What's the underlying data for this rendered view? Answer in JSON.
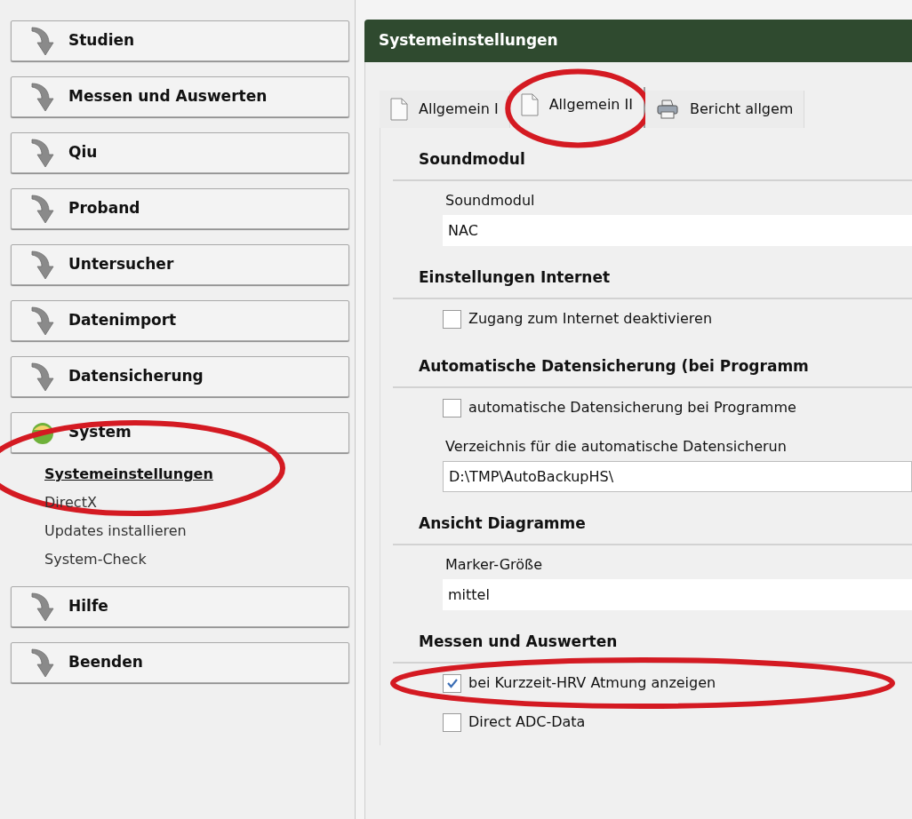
{
  "sidebar": {
    "items": [
      {
        "label": "Studien",
        "expanded": false
      },
      {
        "label": "Messen und Auswerten",
        "expanded": false
      },
      {
        "label": "Qiu",
        "expanded": false
      },
      {
        "label": "Proband",
        "expanded": false
      },
      {
        "label": "Untersucher",
        "expanded": false
      },
      {
        "label": "Datenimport",
        "expanded": false
      },
      {
        "label": "Datensicherung",
        "expanded": false
      },
      {
        "label": "System",
        "expanded": true,
        "children": [
          {
            "label": "Systemeinstellungen",
            "selected": true,
            "highlighted": true
          },
          {
            "label": "DirectX",
            "selected": false,
            "highlighted": false
          },
          {
            "label": "Updates installieren",
            "selected": false,
            "highlighted": false
          },
          {
            "label": "System-Check",
            "selected": false,
            "highlighted": false
          }
        ]
      },
      {
        "label": "Hilfe",
        "expanded": false
      },
      {
        "label": "Beenden",
        "expanded": false
      }
    ]
  },
  "panel": {
    "title": "Systemeinstellungen",
    "tabs": [
      {
        "label": "Allgemein I",
        "selected": false,
        "highlighted": false
      },
      {
        "label": "Allgemein II",
        "selected": true,
        "highlighted": true
      },
      {
        "label": "Bericht allgem",
        "selected": false,
        "highlighted": false
      }
    ],
    "sections": [
      {
        "title": "Soundmodul",
        "items": [
          {
            "kind": "select",
            "label": "Soundmodul",
            "value": "NAC"
          }
        ]
      },
      {
        "title": "Einstellungen Internet",
        "items": [
          {
            "kind": "checkbox",
            "label": "Zugang zum Internet deaktivieren",
            "checked": false,
            "highlighted": false
          }
        ]
      },
      {
        "title": "Automatische Datensicherung (bei Programm",
        "items": [
          {
            "kind": "checkbox",
            "label": "automatische Datensicherung bei Programme",
            "checked": false,
            "highlighted": false
          },
          {
            "kind": "input",
            "label": "Verzeichnis für die automatische Datensicherun",
            "value": "D:\\TMP\\AutoBackupHS\\"
          }
        ]
      },
      {
        "title": "Ansicht Diagramme",
        "items": [
          {
            "kind": "select",
            "label": "Marker-Größe",
            "value": "mittel"
          }
        ]
      },
      {
        "title": "Messen und Auswerten",
        "items": [
          {
            "kind": "checkbox",
            "label": "bei Kurzzeit-HRV Atmung anzeigen",
            "checked": true,
            "highlighted": true
          },
          {
            "kind": "checkbox",
            "label": "Direct ADC-Data",
            "checked": false,
            "highlighted": false
          }
        ]
      }
    ]
  }
}
